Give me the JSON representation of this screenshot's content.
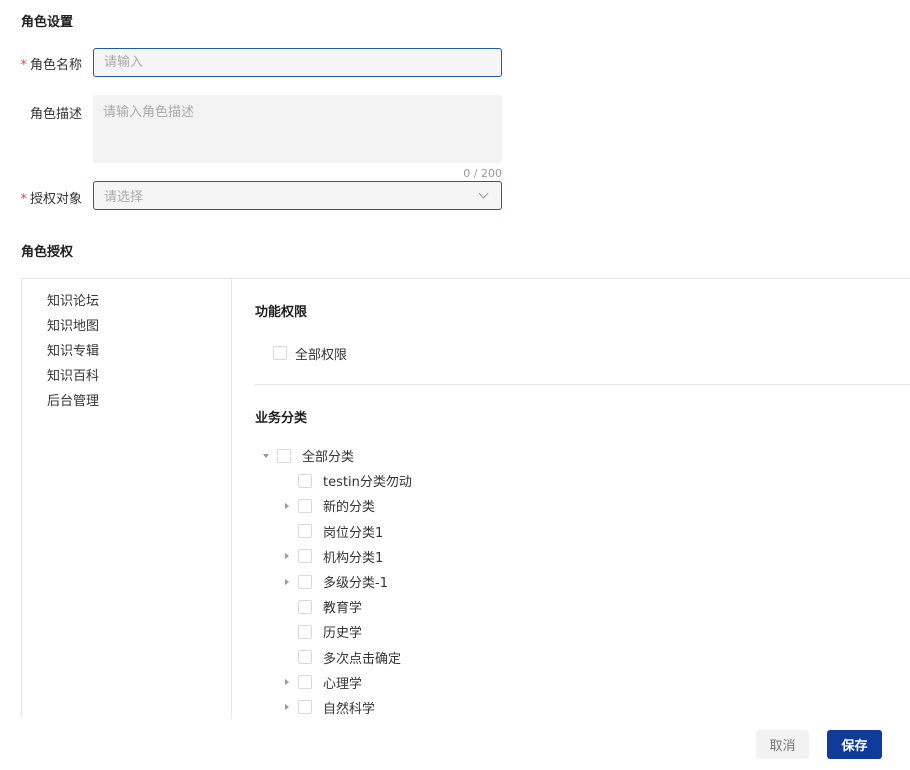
{
  "role_settings": {
    "title": "角色设置",
    "required_mark": "*",
    "name_label": "角色名称",
    "name_placeholder": "请输入",
    "name_value": "",
    "desc_label": "角色描述",
    "desc_placeholder": "请输入角色描述",
    "desc_value": "",
    "desc_counter": "0 / 200",
    "target_label": "授权对象",
    "target_placeholder": "请选择"
  },
  "role_auth": {
    "title": "角色授权",
    "nav_items": [
      "知识论坛",
      "知识地图",
      "知识专辑",
      "知识百科",
      "后台管理"
    ],
    "function_perm": {
      "title": "功能权限",
      "all_label": "全部权限"
    },
    "business": {
      "title": "业务分类",
      "root_label": "全部分类",
      "children": [
        {
          "label": "testin分类勿动",
          "expandable": false
        },
        {
          "label": "新的分类",
          "expandable": true
        },
        {
          "label": "岗位分类1",
          "expandable": false
        },
        {
          "label": "机构分类1",
          "expandable": true
        },
        {
          "label": "多级分类-1",
          "expandable": true
        },
        {
          "label": "教育学",
          "expandable": false
        },
        {
          "label": "历史学",
          "expandable": false
        },
        {
          "label": "多次点击确定",
          "expandable": false
        },
        {
          "label": "心理学",
          "expandable": true
        },
        {
          "label": "自然科学",
          "expandable": true
        }
      ]
    }
  },
  "footer": {
    "cancel_label": "取消",
    "save_label": "保存"
  },
  "colors": {
    "primary": "#0f3b9a",
    "input_border": "#1f5ba8",
    "required": "#e8453c"
  }
}
